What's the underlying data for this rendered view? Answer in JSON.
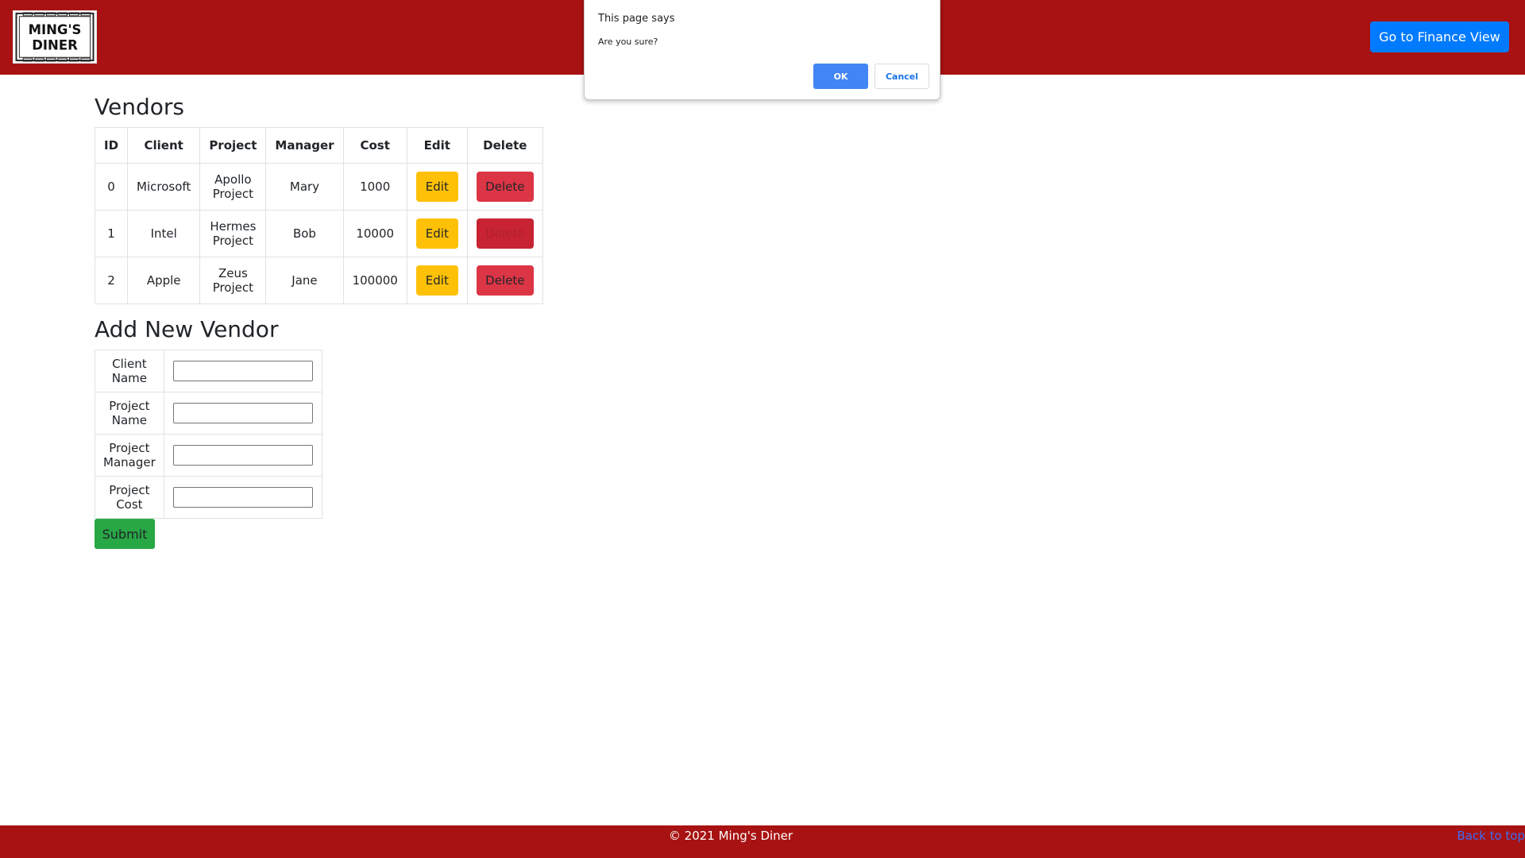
{
  "header": {
    "logo_text": "MING'S DINER",
    "finance_button": "Go to Finance View",
    "brand_color": "#a81212"
  },
  "vendors": {
    "title": "Vendors",
    "columns": [
      "ID",
      "Client",
      "Project",
      "Manager",
      "Cost",
      "Edit",
      "Delete"
    ],
    "rows": [
      {
        "id": "0",
        "client": "Microsoft",
        "project": "Apollo Project",
        "manager": "Mary",
        "cost": "1000",
        "edit": "Edit",
        "delete": "Delete"
      },
      {
        "id": "1",
        "client": "Intel",
        "project": "Hermes Project",
        "manager": "Bob",
        "cost": "10000",
        "edit": "Edit",
        "delete": "Delete"
      },
      {
        "id": "2",
        "client": "Apple",
        "project": "Zeus Project",
        "manager": "Jane",
        "cost": "100000",
        "edit": "Edit",
        "delete": "Delete"
      }
    ]
  },
  "add_vendor": {
    "title": "Add New Vendor",
    "fields": [
      {
        "label": "Client Name",
        "value": ""
      },
      {
        "label": "Project Name",
        "value": ""
      },
      {
        "label": "Project Manager",
        "value": ""
      },
      {
        "label": "Project Cost",
        "value": ""
      }
    ],
    "submit": "Submit"
  },
  "footer": {
    "copyright": "© 2021 Ming's Diner",
    "back_to_top": "Back to top"
  },
  "dialog": {
    "title": "This page says",
    "message": "Are you sure?",
    "ok": "OK",
    "cancel": "Cancel"
  }
}
